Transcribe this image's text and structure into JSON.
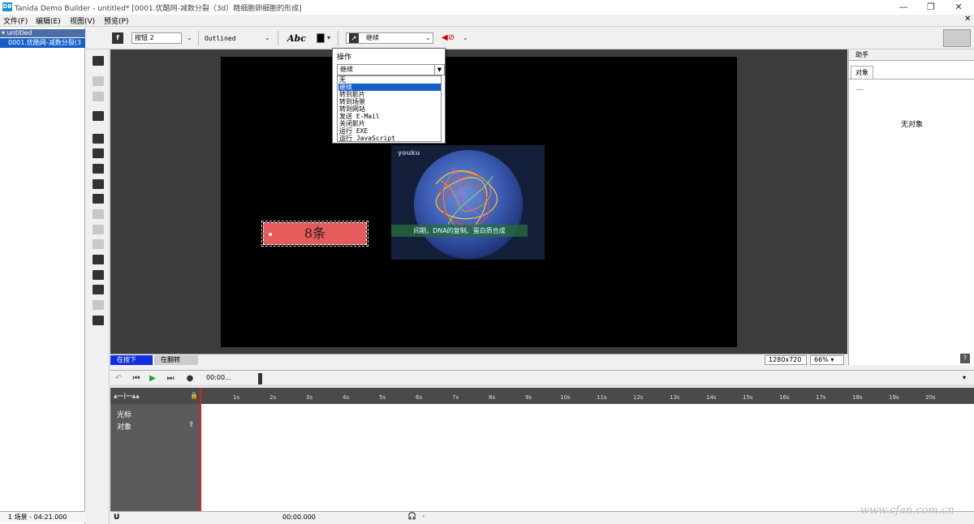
{
  "window": {
    "title": "Tanida Demo Builder - untitled* [0001.优酷网-减数分裂（3d）精细胞卵细胞的形成]",
    "controls": [
      "—",
      "❐",
      "✕"
    ]
  },
  "menu": [
    "文件(F)",
    "编辑(E)",
    "视图(V)",
    "预览(P)"
  ],
  "scenes": {
    "root": "untitled",
    "items": [
      "0001.优酷网-减数分裂(3"
    ],
    "footer": "1 场景 - 04:21.000"
  },
  "toolbar": {
    "button_name": "按钮 2",
    "style": "Outlined",
    "font_sample": "Abc",
    "action": "继续"
  },
  "canvas": {
    "button_text": "8条",
    "video_logo": "youku",
    "video_caption": "间期，DNA的复制、蛋白质合成"
  },
  "dropdown": {
    "label": "操作",
    "selected": "继续",
    "options": [
      "无",
      "继续",
      "转到影片",
      "转到场景",
      "转到网站",
      "发送 E-Mail",
      "关闭影片",
      "运行 EXE",
      "运行 JavaScript"
    ],
    "highlighted_index": 1
  },
  "canvas_status": {
    "tab_pressed": "在按下",
    "tab_hover": "在翻转",
    "resolution": "1280x720",
    "zoom": "66%"
  },
  "helper": {
    "title": "助手",
    "tab": "对象",
    "dash": "—",
    "empty": "无对象",
    "help": "?"
  },
  "timeline": {
    "time": "00:00...",
    "ticks": [
      "1s",
      "2s",
      "3s",
      "4s",
      "5s",
      "6s",
      "7s",
      "8s",
      "9s",
      "10s",
      "11s",
      "12s",
      "13s",
      "14s",
      "15s",
      "16s",
      "17s",
      "18s",
      "19s",
      "20s"
    ],
    "rows": [
      "光标",
      "对象"
    ],
    "bottom_time": "00:00.000"
  },
  "watermark": "www.cfan.com.cn"
}
